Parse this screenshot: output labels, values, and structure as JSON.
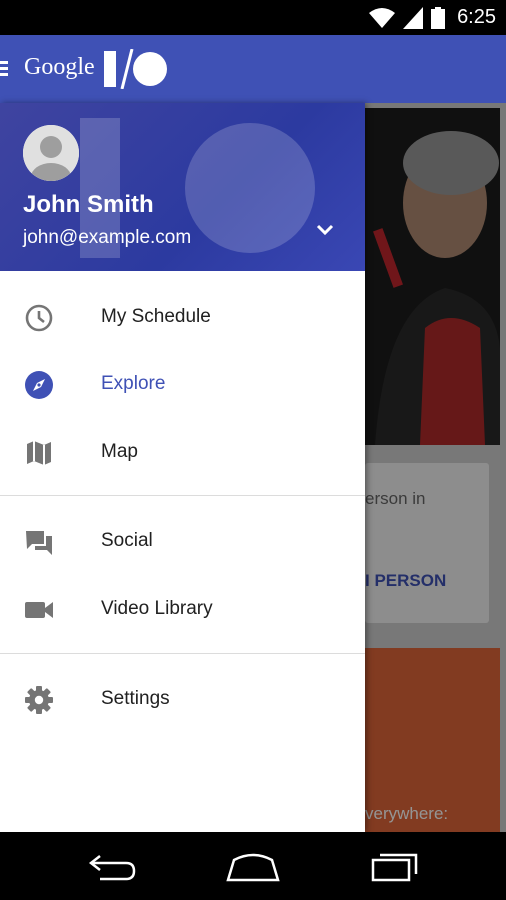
{
  "status_bar": {
    "time": "6:25"
  },
  "app_bar": {
    "brand": "Google"
  },
  "account": {
    "name": "John Smith",
    "email": "john@example.com"
  },
  "nav": {
    "items": [
      {
        "label": "My Schedule",
        "icon": "clock-icon"
      },
      {
        "label": "Explore",
        "icon": "compass-icon",
        "active": true
      },
      {
        "label": "Map",
        "icon": "map-icon"
      },
      {
        "label": "Social",
        "icon": "chat-bubbles-icon"
      },
      {
        "label": "Video Library",
        "icon": "videocam-icon"
      },
      {
        "label": "Settings",
        "icon": "gear-icon"
      }
    ]
  },
  "background_cards": {
    "card1_text": "erson in",
    "card1_action": "I PERSON",
    "card2_text": "verywhere:"
  },
  "colors": {
    "primary": "#3f51b5",
    "accent_orange": "#e0673a"
  }
}
